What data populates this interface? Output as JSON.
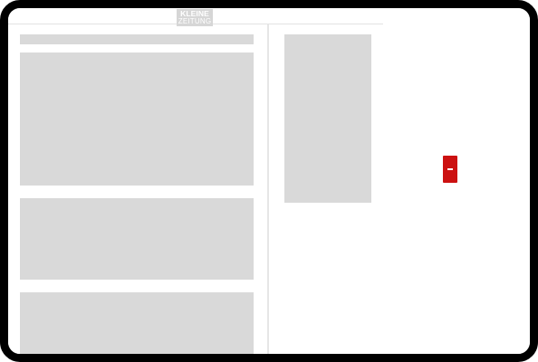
{
  "header": {
    "logo": {
      "line1": "KLEINE",
      "line2": "ZEITUNG"
    }
  },
  "widget": {
    "icon": "minus-icon",
    "color": "#cc1111"
  },
  "colors": {
    "placeholder": "#d9d9d9",
    "frame": "#000000",
    "accent": "#cc1111"
  }
}
